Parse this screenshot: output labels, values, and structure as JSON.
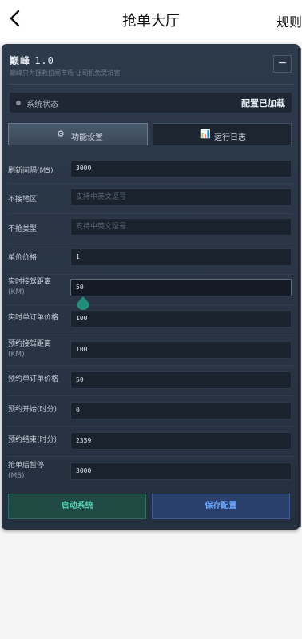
{
  "nav": {
    "title": "抢单大厅",
    "right": "规则"
  },
  "panel": {
    "title": "巅峰",
    "version": "1.0",
    "subtitle": "巅峰只为拯救拉闸市场 让司机免受坑害",
    "minimize": "−",
    "status": {
      "label": "系统状态",
      "value": "配置已加载"
    },
    "tabs": [
      {
        "icon": "⚙",
        "label": "功能设置"
      },
      {
        "icon": "📊",
        "label": "运行日志"
      }
    ],
    "fields": [
      {
        "label": "刷新间隔(MS)",
        "value": "3000"
      },
      {
        "label": "不接地区",
        "placeholder": "支持中英文逗号"
      },
      {
        "label": "不抢类型",
        "placeholder": "支持中英文逗号"
      },
      {
        "label": "单价价格",
        "value": "1"
      },
      {
        "label": "实时接驾距离",
        "label2": "(KM)",
        "value": "50"
      },
      {
        "label": "实时单订单价格",
        "value": "100"
      },
      {
        "label": "预约接驾距离",
        "label2": "(KM)",
        "value": "100"
      },
      {
        "label": "预约单订单价格",
        "value": "50"
      },
      {
        "label": "预约开始(时分)",
        "value": "0"
      },
      {
        "label": "预约结束(时分)",
        "value": "2359"
      },
      {
        "label": "抢单后暂停",
        "label2": "(MS)",
        "value": "3000"
      }
    ],
    "buttons": {
      "start": "启动系统",
      "save": "保存配置"
    }
  },
  "colors": {
    "start": "#4fd1b0",
    "save": "#6aa8ff",
    "handle": "#1f8f7a"
  }
}
